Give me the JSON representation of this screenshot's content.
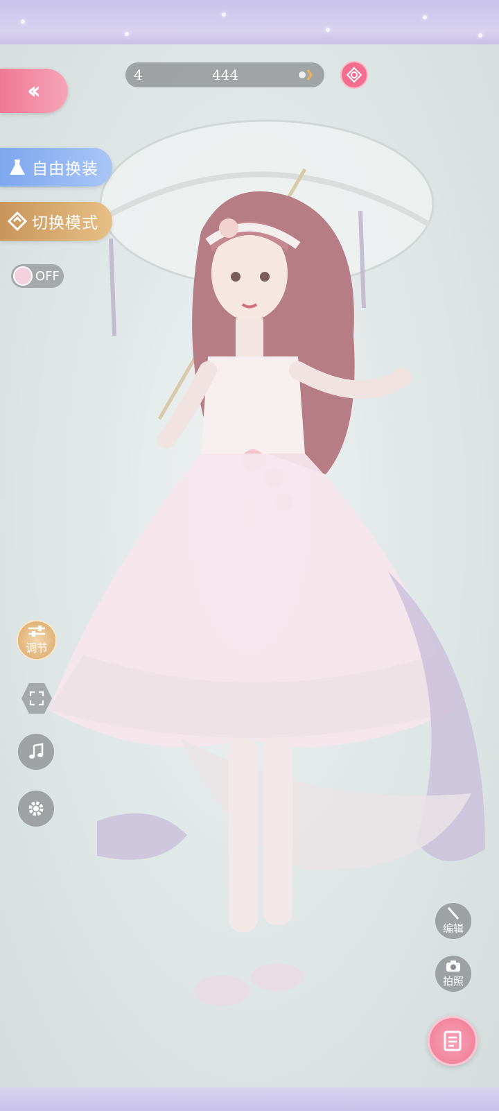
{
  "hud": {
    "counter_left": "4",
    "counter_value": "444"
  },
  "left_menu": {
    "free_dress_label": "自由换装",
    "switch_mode_label": "切换模式",
    "toggle_label": "OFF",
    "adjust_label": "调节"
  },
  "right_menu": {
    "edit_label": "编辑",
    "photo_label": "拍照"
  },
  "icons": {
    "back": "double-chevron-left-icon",
    "pink_round": "photo-frame-icon",
    "free_dress": "dress-icon",
    "switch_mode": "switch-icon",
    "toggle": "avatar-face-icon",
    "adjust": "sliders-icon",
    "fullscreen": "fullscreen-icon",
    "music": "music-note-icon",
    "settings": "gear-icon",
    "edit": "pencil-icon",
    "photo": "camera-icon",
    "save": "save-document-icon"
  },
  "colors": {
    "accent_pink": "#f07896",
    "blue_pill": "#7ea7ee",
    "gold_pill": "#c9955a",
    "overlay_gray": "#6e6e73"
  }
}
